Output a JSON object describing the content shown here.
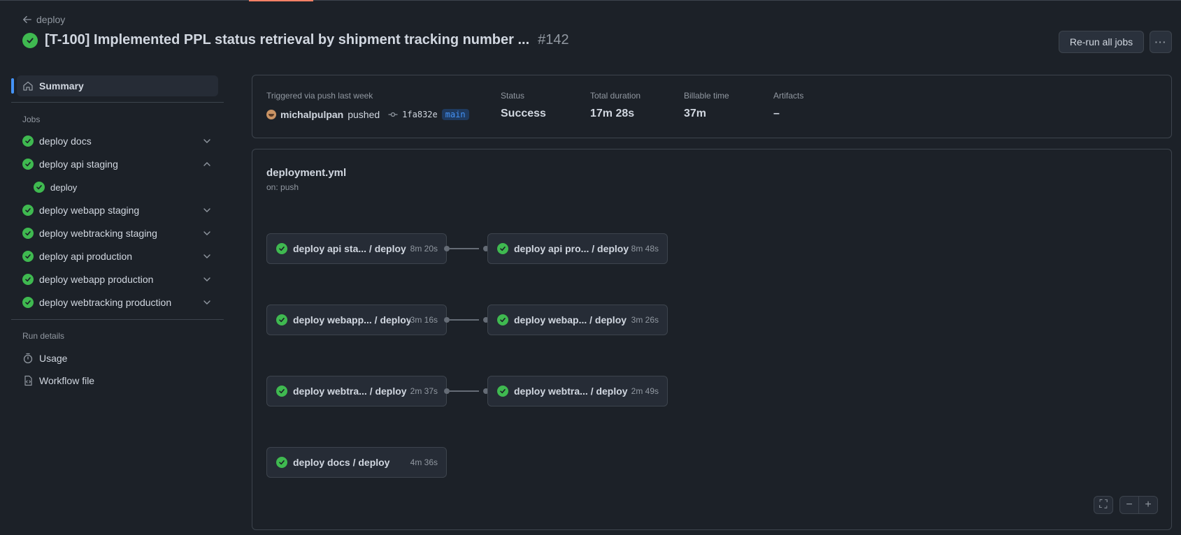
{
  "header": {
    "back_label": "deploy",
    "title": "[T-100] Implemented PPL status retrieval by shipment tracking number ...",
    "run_number": "#142",
    "rerun_label": "Re-run all jobs",
    "kebab_label": "···"
  },
  "sidebar": {
    "summary_label": "Summary",
    "jobs_heading": "Jobs",
    "jobs": [
      {
        "label": "deploy docs",
        "expanded": false
      },
      {
        "label": "deploy api staging",
        "expanded": true,
        "children": [
          {
            "label": "deploy"
          }
        ]
      },
      {
        "label": "deploy webapp staging",
        "expanded": false
      },
      {
        "label": "deploy webtracking staging",
        "expanded": false
      },
      {
        "label": "deploy api production",
        "expanded": false
      },
      {
        "label": "deploy webapp production",
        "expanded": false
      },
      {
        "label": "deploy webtracking production",
        "expanded": false
      }
    ],
    "run_details_heading": "Run details",
    "links": [
      {
        "label": "Usage",
        "icon": "stopwatch-icon"
      },
      {
        "label": "Workflow file",
        "icon": "file-code-icon"
      }
    ]
  },
  "summary": {
    "trigger_label": "Triggered via push last week",
    "user": "michalpulpan",
    "action": "pushed",
    "commit_sha": "1fa832e",
    "branch": "main",
    "status_label": "Status",
    "status_value": "Success",
    "duration_label": "Total duration",
    "duration_value": "17m 28s",
    "billable_label": "Billable time",
    "billable_value": "37m",
    "artifacts_label": "Artifacts",
    "artifacts_value": "–"
  },
  "workflow": {
    "file": "deployment.yml",
    "trigger": "on: push",
    "nodes": [
      {
        "label": "deploy api sta...  / deploy",
        "duration": "8m 20s"
      },
      {
        "label": "deploy api pro...  / deploy",
        "duration": "8m 48s"
      },
      {
        "label": "deploy webapp... / deploy",
        "duration": "3m 16s"
      },
      {
        "label": "deploy webap...  / deploy",
        "duration": "3m 26s"
      },
      {
        "label": "deploy webtra...  / deploy",
        "duration": "2m 37s"
      },
      {
        "label": "deploy webtra...  / deploy",
        "duration": "2m 49s"
      },
      {
        "label": "deploy docs / deploy",
        "duration": "4m 36s"
      }
    ],
    "controls": {
      "fullscreen": "⛶",
      "zoom_out": "−",
      "zoom_in": "+"
    }
  },
  "colors": {
    "success": "#3fb950",
    "accent": "#4493f8",
    "background": "#1c2128"
  }
}
